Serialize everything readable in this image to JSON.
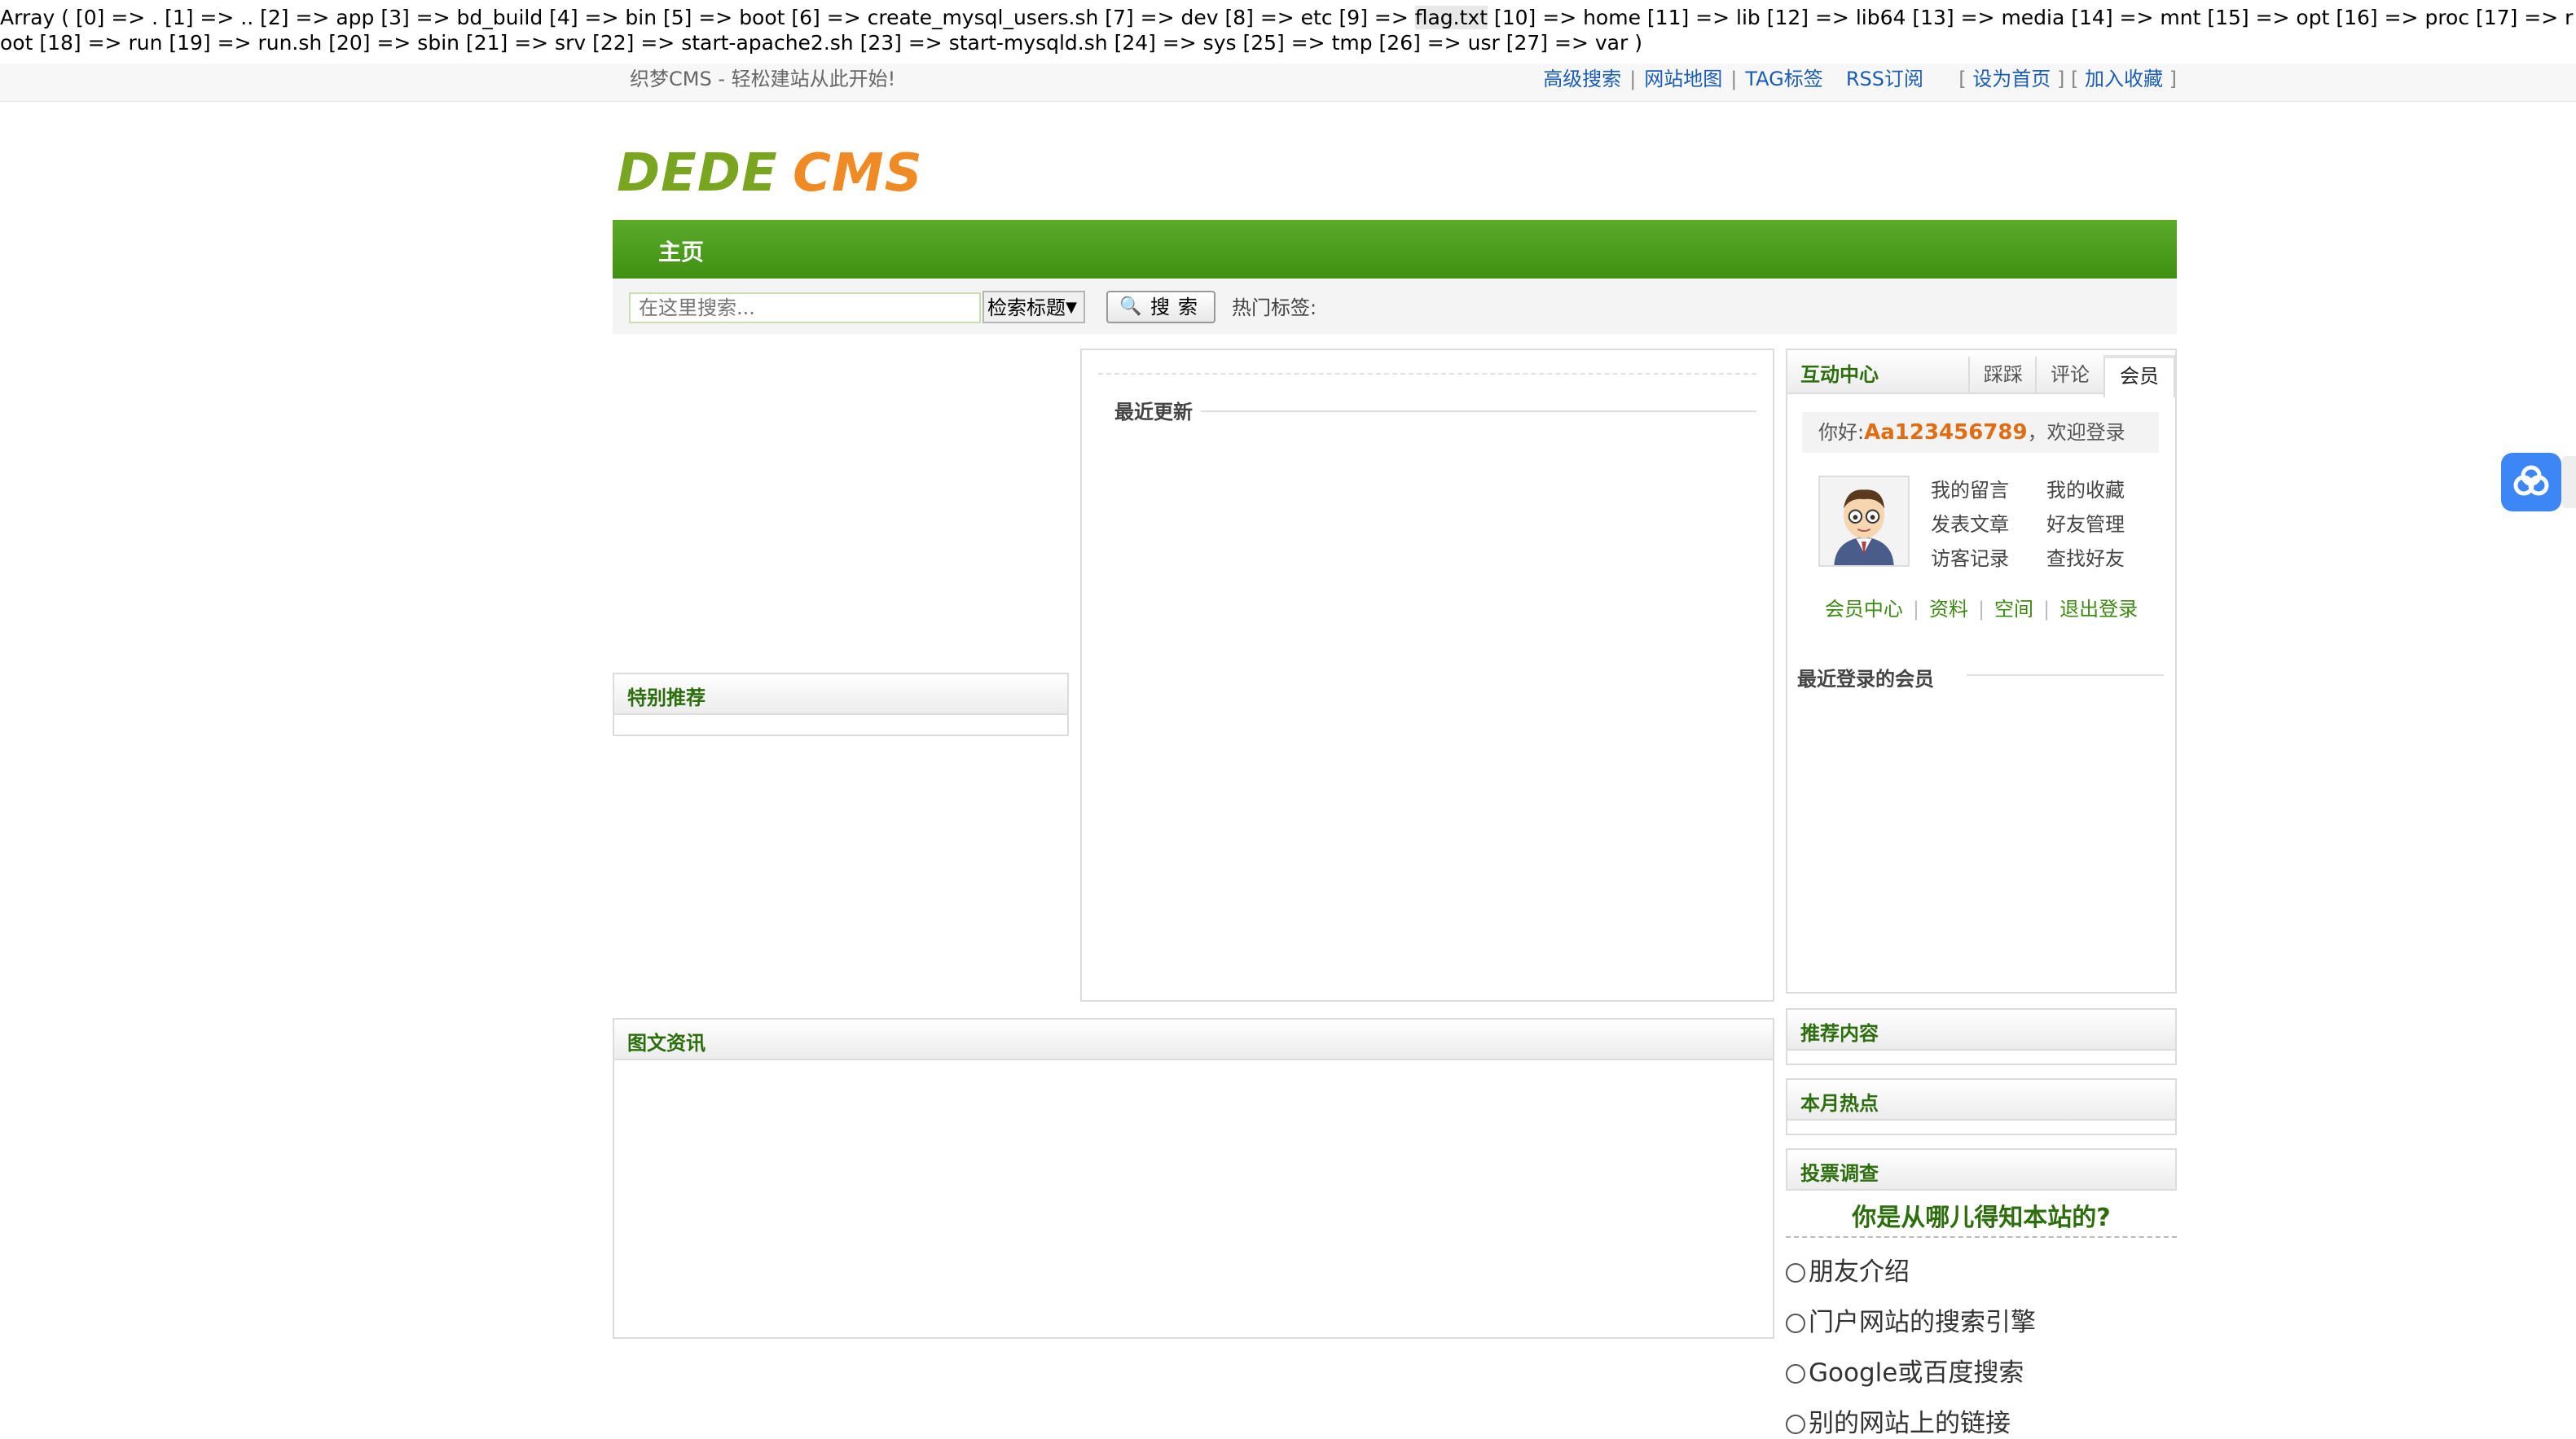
{
  "debug": {
    "before": "Array ( [0] => . [1] => .. [2] => app [3] => bd_build [4] => bin [5] => boot [6] => create_mysql_users.sh [7] => dev [8] => etc [9] => ",
    "highlight": "flag.txt",
    "after": " [10] => home [11] => lib [12] => lib64 [13] => media [14] => mnt [15] => opt [16] => proc [17] => root [18] => run [19] => run.sh [20] => sbin [21] => srv [22] => start-apache2.sh [23] => start-mysqld.sh [24] => sys [25] => tmp [26] => usr [27] => var )"
  },
  "header": {
    "slogan": "织梦CMS - 轻松建站从此开始!",
    "links": [
      "高级搜索",
      "网站地图",
      "TAG标签",
      "RSS订阅"
    ],
    "set_home": "设为首页",
    "bookmark": "加入收藏"
  },
  "logo": {
    "text": "DEDECMS"
  },
  "nav": {
    "home": "主页"
  },
  "search": {
    "placeholder": "在这里搜索...",
    "select_value": "检索标题",
    "button_label": "搜索",
    "hot_tags_label": "热门标签:"
  },
  "left": {
    "special_title": "特别推荐"
  },
  "center": {
    "recent_title": "最近更新"
  },
  "pictures": {
    "title": "图文资讯"
  },
  "member": {
    "title": "互动中心",
    "tabs": [
      "踩踩",
      "评论",
      "会员"
    ],
    "hello": "你好:",
    "username": "Aa123456789",
    "welcome": "，欢迎登录",
    "links": [
      "我的留言",
      "我的收藏",
      "发表文章",
      "好友管理",
      "访客记录",
      "查找好友"
    ],
    "bottom_links": [
      "会员中心",
      "资料",
      "空间",
      "退出登录"
    ],
    "recent_title": "最近登录的会员"
  },
  "side": {
    "recommend": "推荐内容",
    "month_hot": "本月热点",
    "vote_title": "投票调查"
  },
  "vote": {
    "question": "你是从哪儿得知本站的?",
    "options": [
      "朋友介绍",
      "门户网站的搜索引擎",
      "Google或百度搜索",
      "别的网站上的链接"
    ]
  },
  "colors": {
    "nav_green": "#4b9c1c",
    "title_green": "#2d6e0c",
    "username_orange": "#e06d14",
    "link_blue": "#1a5db3",
    "widget_blue": "#3d86f5"
  }
}
